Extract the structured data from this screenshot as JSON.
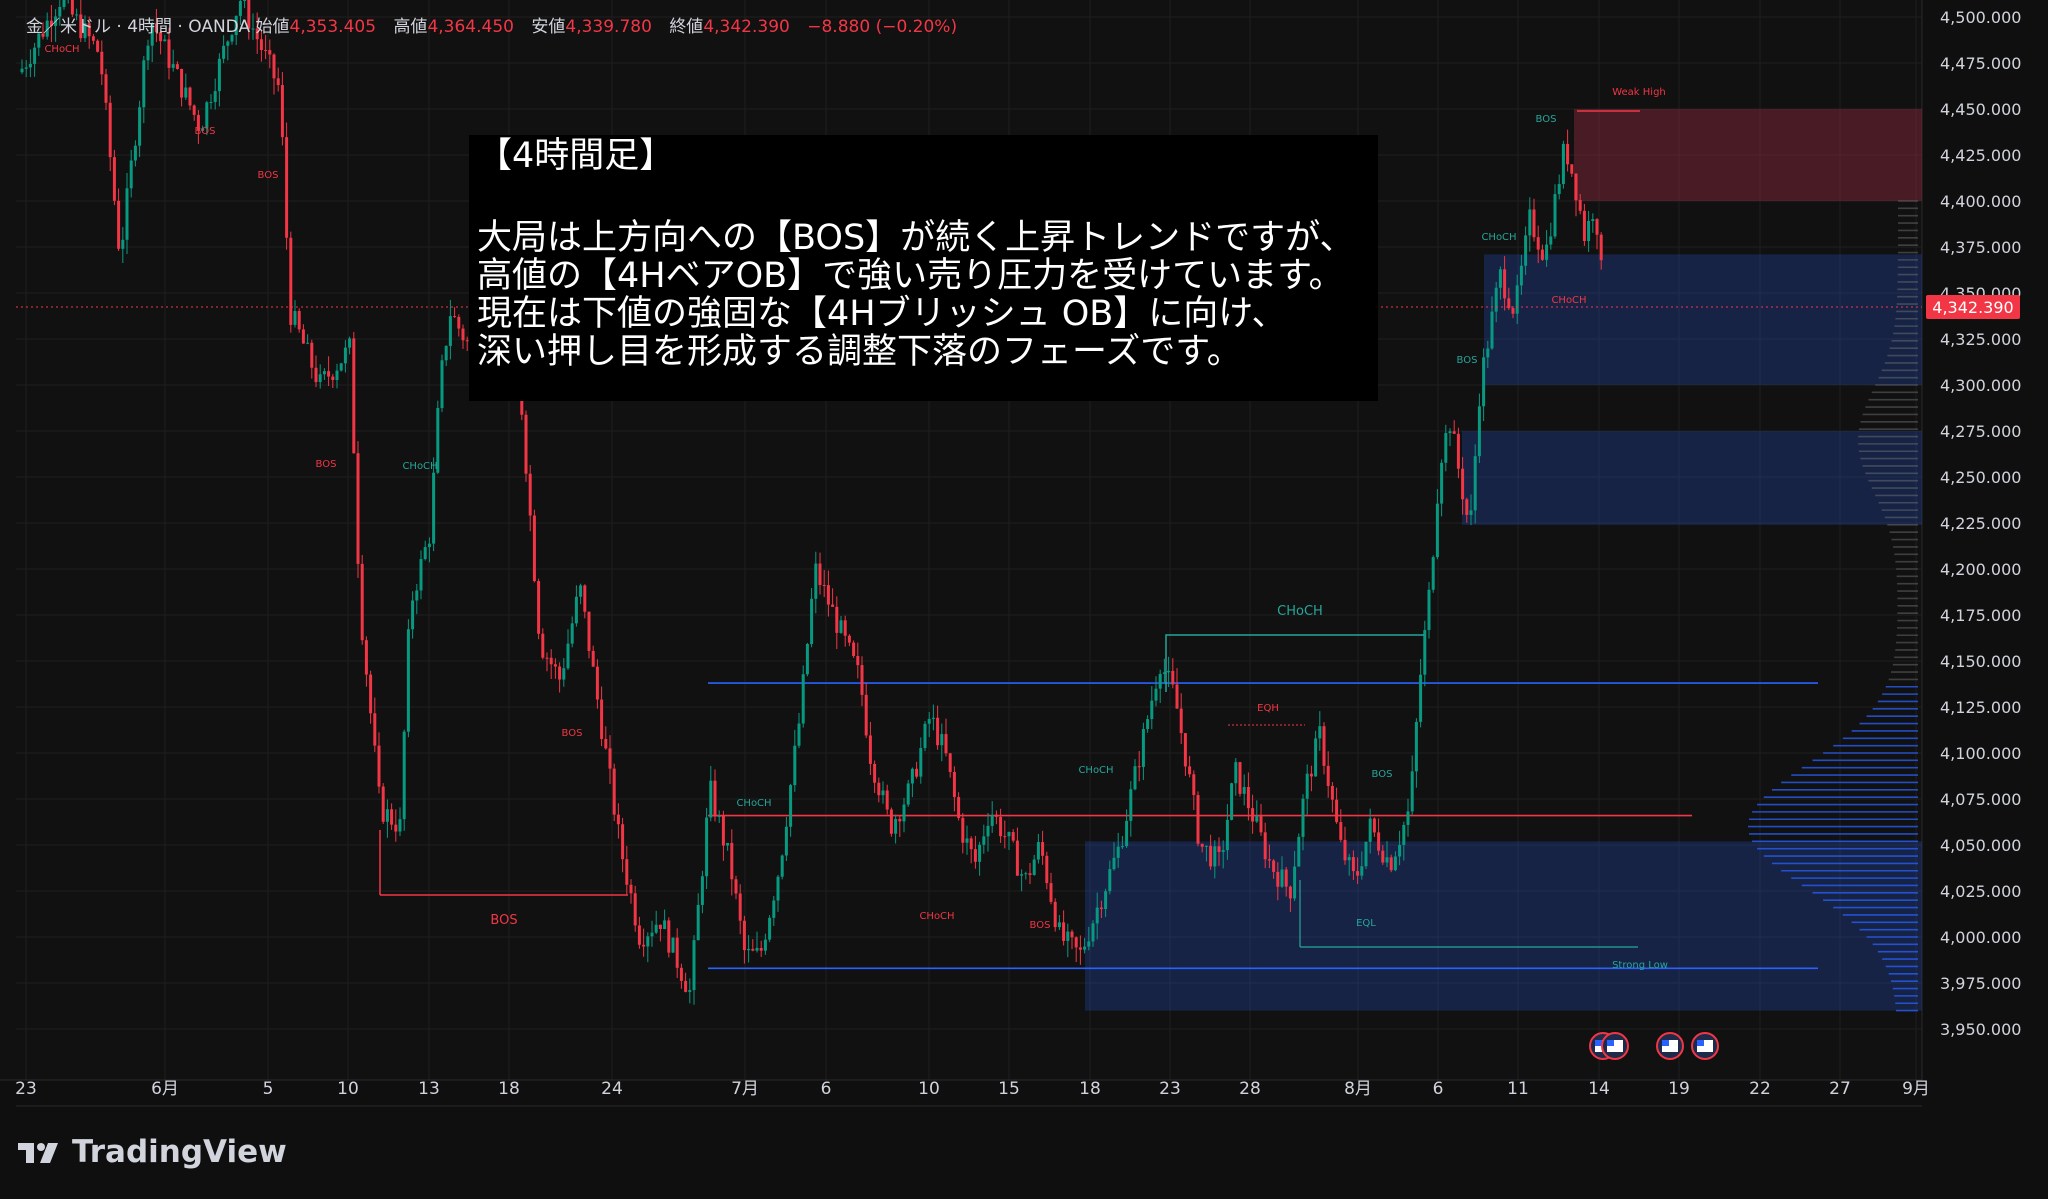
{
  "header": {
    "symbol": "金／米ドル · 4時間 · OANDA",
    "open_label": "始値",
    "open": "4,353.405",
    "high_label": "高値",
    "high": "4,364.450",
    "low_label": "安値",
    "low": "4,339.780",
    "close_label": "終値",
    "close": "4,342.390",
    "change": "−8.880 (−0.20%)"
  },
  "note": {
    "title": "【4時間足】",
    "lines": [
      "大局は上方向への【BOS】が続く上昇トレンドですが、",
      "高値の【4HベアOB】で強い売り圧力を受けています。",
      "現在は下値の強固な【4Hブリッシュ OB】に向け、",
      "深い押し目を形成する調整下落のフェーズです。"
    ]
  },
  "footer": {
    "brand": "TradingView"
  },
  "chart_data": {
    "type": "candlestick",
    "y_ticks": [
      "4,500.000",
      "4,475.000",
      "4,450.000",
      "4,425.000",
      "4,400.000",
      "4,375.000",
      "4,350.000",
      "4,325.000",
      "4,300.000",
      "4,275.000",
      "4,250.000",
      "4,225.000",
      "4,200.000",
      "4,175.000",
      "4,150.000",
      "4,125.000",
      "4,100.000",
      "4,075.000",
      "4,050.000",
      "4,025.000",
      "4,000.000",
      "3,975.000",
      "3,950.000"
    ],
    "x_ticks": [
      "23",
      "6月",
      "5",
      "10",
      "13",
      "18",
      "24",
      "7月",
      "6",
      "10",
      "15",
      "18",
      "23",
      "28",
      "8月",
      "6",
      "11",
      "14",
      "19",
      "22",
      "27",
      "9月"
    ],
    "last_price": "4,342.390",
    "ylim": [
      3940,
      4510
    ],
    "colors": {
      "up": "#089981",
      "down": "#f23645",
      "ob_blue": "#2962ff",
      "ob_red": "#b2304a"
    },
    "annotations": {
      "bos": "BOS",
      "choch": "CHoCH",
      "eqh": "EQH",
      "eql": "EQL",
      "weak_high": "Weak High",
      "strong_low": "Strong Low"
    },
    "key_levels": [
      {
        "price": 4138,
        "color": "#2962ff"
      },
      {
        "price": 4066,
        "color": "#f23645"
      },
      {
        "price": 3983,
        "color": "#2962ff"
      }
    ],
    "zones": [
      {
        "top": 4450,
        "bottom": 4400,
        "color": "red"
      },
      {
        "top": 4371,
        "bottom": 4300,
        "color": "blue"
      },
      {
        "top": 4275,
        "bottom": 4224,
        "color": "blue"
      },
      {
        "top": 4052,
        "bottom": 3960,
        "color": "blue"
      }
    ]
  }
}
